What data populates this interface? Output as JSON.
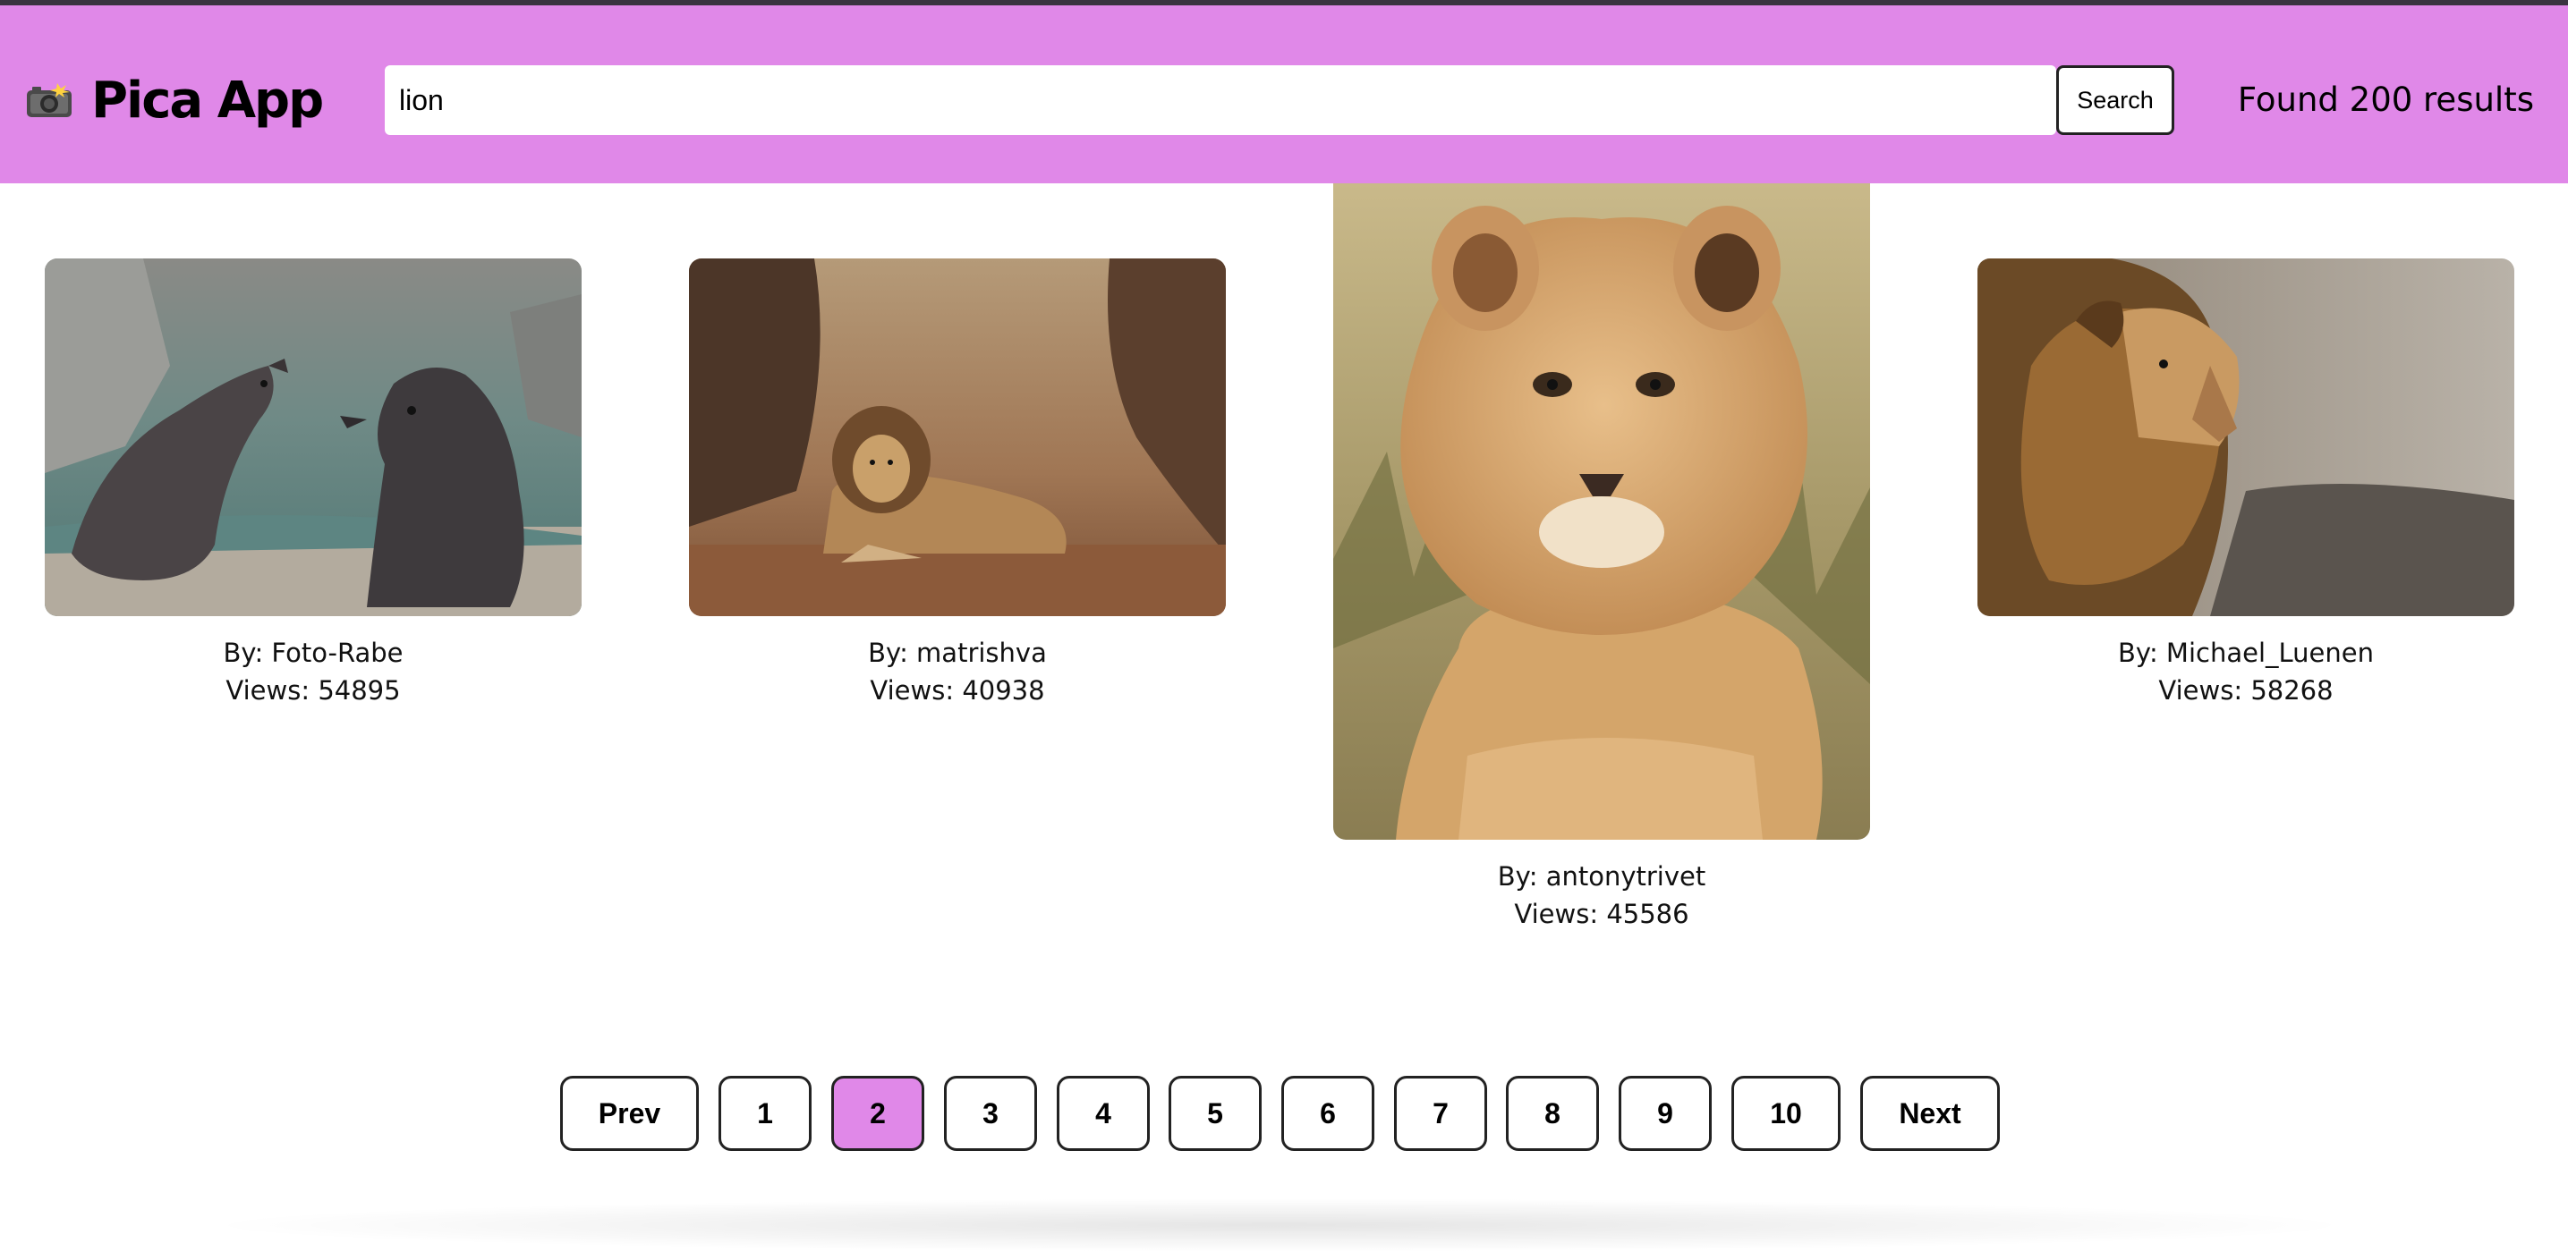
{
  "header": {
    "app_title": "Pica App",
    "logo_icon": "camera-flash-icon",
    "background_color": "#e088e8"
  },
  "search": {
    "value": "lion",
    "button_label": "Search"
  },
  "results": {
    "count_text": "Found 200 results"
  },
  "cards": [
    {
      "by": "By: Foto-Rabe",
      "views": "Views: 54895",
      "image": "sea-lions-photo"
    },
    {
      "by": "By: matrishva",
      "views": "Views: 40938",
      "image": "lion-resting-in-brush-photo"
    },
    {
      "by": "By: antonytrivet",
      "views": "Views: 45586",
      "image": "lion-cub-photo"
    },
    {
      "by": "By: Michael_Luenen",
      "views": "Views: 58268",
      "image": "lion-profile-photo"
    }
  ],
  "pagination": {
    "prev_label": "Prev",
    "next_label": "Next",
    "pages": [
      "1",
      "2",
      "3",
      "4",
      "5",
      "6",
      "7",
      "8",
      "9",
      "10"
    ],
    "current_page": "2",
    "active_color": "#e088e8"
  }
}
